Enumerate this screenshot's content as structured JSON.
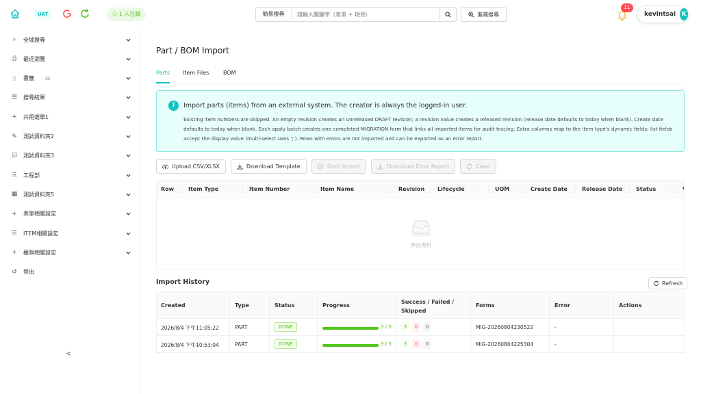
{
  "header": {
    "env_badge": "UAT",
    "online": "1 人在線",
    "search_scope": "簡易搜尋",
    "search_placeholder": "請輸入關鍵字（表單 + 項目）",
    "advanced_search": "進階搜尋",
    "notification_count": "11",
    "username": "kevintsai",
    "avatar_letter": "K"
  },
  "sidebar": {
    "items": [
      {
        "icon": "search-icon",
        "label": "全域搜尋"
      },
      {
        "icon": "history-icon",
        "label": "最近瀏覽"
      },
      {
        "icon": "bookmark-icon",
        "label": "書籤"
      },
      {
        "icon": "list-icon",
        "label": "搜尋結果"
      },
      {
        "icon": "plus-icon",
        "label": "共用選單1"
      },
      {
        "icon": "edit-icon",
        "label": "測試資料夾2"
      },
      {
        "icon": "check-square-icon",
        "label": "測試資料夾3"
      },
      {
        "icon": "copy-icon",
        "label": "工程部"
      },
      {
        "icon": "table-icon",
        "label": "測試資料夾5"
      },
      {
        "icon": "plus-icon",
        "label": "表單相關設定"
      },
      {
        "icon": "copy-icon",
        "label": "ITEM相關設定"
      },
      {
        "icon": "plus-icon",
        "label": "權限相關設定"
      },
      {
        "icon": "logout-icon",
        "label": "登出"
      }
    ],
    "collapse": "<"
  },
  "page": {
    "title": "Part / BOM Import",
    "tabs": [
      "Parts",
      "Item Files",
      "BOM"
    ],
    "active_tab": "Parts"
  },
  "info": {
    "title": "Import parts (items) from an external system. The creator is always the logged-in user.",
    "description": "Existing item numbers are skipped. An empty revision creates an unreleased DRAFT revision; a revision value creates a released revision (release date defaults to today when blank). Create date defaults to today when blank. Each apply batch creates one completed MIGRATION form that links all imported items for audit tracing. Extra columns map to the item type's dynamic fields; list fields accept the display value (multi-select uses ';'). Rows with errors are not imported and can be exported as an error report."
  },
  "actions": {
    "upload": "Upload CSV/XLSX",
    "download_template": "Download Template",
    "start_import": "Start Import",
    "download_error": "Download Error Report",
    "clear": "Clear"
  },
  "preview_table": {
    "columns": [
      "Row",
      "Item Type",
      "Item Number",
      "Item Name",
      "Revision",
      "Lifecycle",
      "UOM",
      "Create Date",
      "Release Date",
      "Status",
      "V"
    ],
    "empty_text": "無此資料"
  },
  "history": {
    "title": "Import History",
    "refresh": "Refresh",
    "columns": [
      "Created",
      "Type",
      "Status",
      "Progress",
      "Success / Failed / Skipped",
      "Forms",
      "Error",
      "Actions"
    ],
    "rows": [
      {
        "created": "2026/8/4 下午11:05:22",
        "type": "PART",
        "status": "DONE",
        "progress": "3 / 3",
        "progress_fraction": 1.0,
        "success": "3",
        "failed": "0",
        "skipped": "0",
        "form": "MIG-20260804230522",
        "error": "-"
      },
      {
        "created": "2026/8/4 下午10:53:04",
        "type": "PART",
        "status": "DONE",
        "progress": "3 / 3",
        "progress_fraction": 1.0,
        "success": "3",
        "failed": "0",
        "skipped": "0",
        "form": "MIG-20260804225304",
        "error": "-"
      }
    ]
  },
  "colors": {
    "accent": "#13c2c2",
    "success": "#52c41a",
    "danger": "#ff4d4f"
  }
}
